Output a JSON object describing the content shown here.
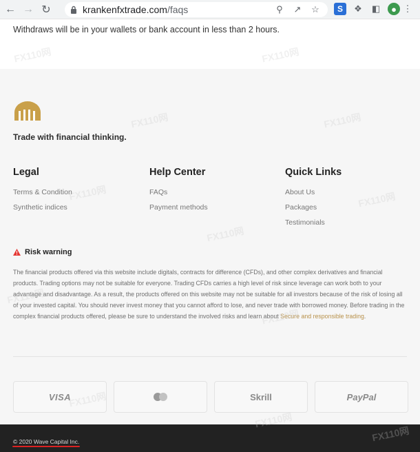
{
  "browser": {
    "url_domain": "krankenfxtrade.com",
    "url_path": "/faqs",
    "ext_s_label": "S"
  },
  "page": {
    "top_text": "Withdraws will be in your wallets or bank account in less than 2 hours."
  },
  "footer": {
    "tagline": "Trade with financial thinking.",
    "legal": {
      "title": "Legal",
      "items": [
        "Terms & Condition",
        "Synthetic indices"
      ]
    },
    "help": {
      "title": "Help Center",
      "items": [
        "FAQs",
        "Payment methods"
      ]
    },
    "quick": {
      "title": "Quick Links",
      "items": [
        "About Us",
        "Packages",
        "Testimonials"
      ]
    },
    "risk": {
      "title": "Risk warning",
      "body": "The financial products offered via this website include digitals, contracts for difference (CFDs), and other complex derivatives and financial products. Trading options may not be suitable for everyone. Trading CFDs carries a high level of risk since leverage can work both to your advantage and disadvantage. As a result, the products offered on this website may not be suitable for all investors because of the risk of losing all of your invested capital. You should never invest money that you cannot afford to lose, and never trade with borrowed money. Before trading in the complex financial products offered, please be sure to understand the involved risks and learn about ",
      "link": "Secure and responsible trading",
      "end": "."
    },
    "payments": {
      "visa": "VISA",
      "skrill": "Skrill",
      "paypal": "PayPal"
    },
    "copyright": "© 2020 Wave Capital Inc."
  },
  "watermark": {
    "text": "FX110网"
  },
  "colors": {
    "accent_gold": "#b8914a",
    "footer_bg": "#f6f6f6",
    "bottom_bar": "#222222",
    "warning_red": "#e53935"
  }
}
